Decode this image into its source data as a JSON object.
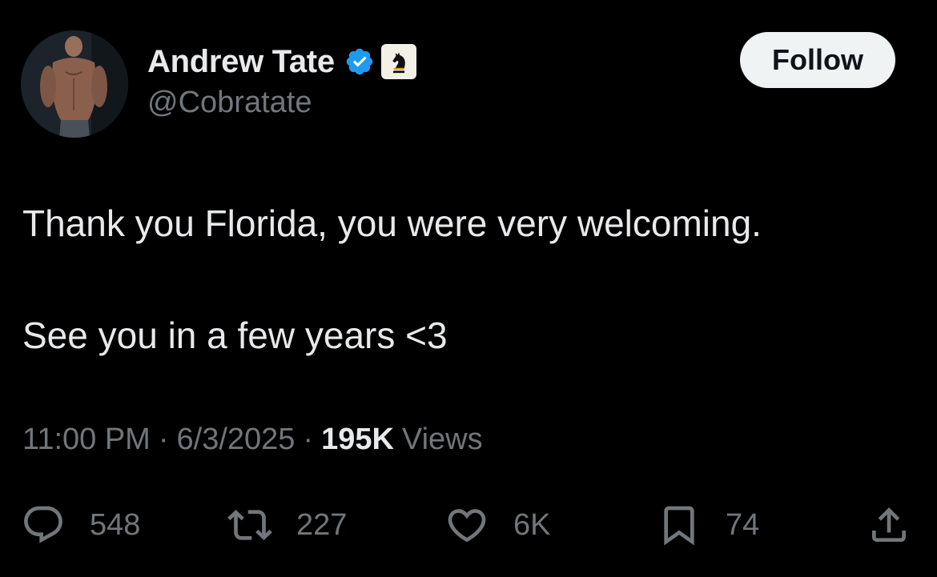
{
  "author": {
    "display_name": "Andrew Tate",
    "handle": "@Cobratate",
    "verified": true,
    "verified_color": "#1d9bf0",
    "affiliate_badge_icon": "chess-knight-icon"
  },
  "follow_button": {
    "label": "Follow"
  },
  "tweet": {
    "line1": "Thank you Florida, you were very welcoming.",
    "line2": "See you in a few years <3"
  },
  "meta": {
    "time": "11:00 PM",
    "separator": "·",
    "date": "6/3/2025",
    "views_count": "195K",
    "views_label": "Views"
  },
  "actions": {
    "replies": "548",
    "reposts": "227",
    "likes": "6K",
    "bookmarks": "74"
  },
  "colors": {
    "background": "#000000",
    "text_primary": "#e7e9ea",
    "text_secondary": "#71767b",
    "follow_bg": "#eff3f4"
  }
}
